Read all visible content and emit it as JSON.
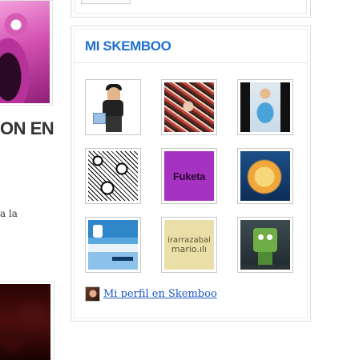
{
  "left_column": {
    "heading_fragment": "ON EN",
    "text_fragment": "a la"
  },
  "widget": {
    "title": "MI SKEMBOO",
    "thumbnails": [
      {
        "name": "thumb-character-illustration"
      },
      {
        "name": "thumb-red-illustration"
      },
      {
        "name": "thumb-woman-illustration"
      },
      {
        "name": "thumb-black-white-doodles"
      },
      {
        "name": "thumb-fuketa-logo",
        "text": "Fuketa"
      },
      {
        "name": "thumb-blonde-character"
      },
      {
        "name": "thumb-blue-business-card"
      },
      {
        "name": "thumb-irarrazabal-mario",
        "line1": "irarrazabal",
        "line2": "mario.ılı"
      },
      {
        "name": "thumb-green-monster"
      }
    ],
    "profile_link": "Mi perfil en Skemboo",
    "colors": {
      "title": "#1f6fd0",
      "link": "#1d58c7",
      "border": "#dcdcdc"
    }
  }
}
